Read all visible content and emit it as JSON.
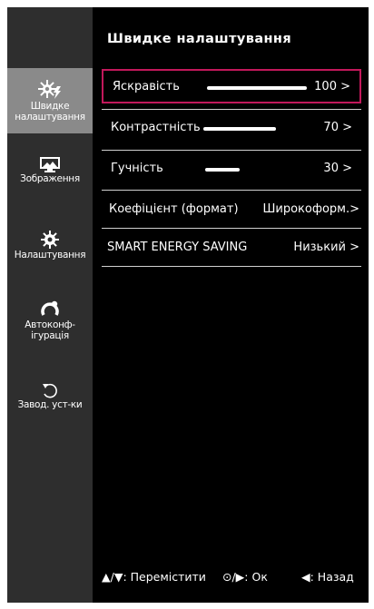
{
  "sidebar": {
    "items": [
      {
        "label1": "Швидке",
        "label2": "налаштування",
        "icon": "quick-settings-icon",
        "active": true
      },
      {
        "label1": "Зображення",
        "icon": "picture-icon",
        "active": false
      },
      {
        "label1": "Налаштування",
        "icon": "gear-icon",
        "active": false
      },
      {
        "label1": "Автоконф-",
        "label2": "ігурація",
        "icon": "auto-config-icon",
        "active": false
      },
      {
        "label1": "Завод. уст-ки",
        "icon": "reset-icon",
        "active": false
      }
    ]
  },
  "main": {
    "title": "Швидке налаштування",
    "rows": [
      {
        "label": "Яскравість",
        "value": "100 >",
        "slider": 1.0,
        "selected": true
      },
      {
        "label": "Контрастність",
        "value": "70 >",
        "slider": 0.7
      },
      {
        "label": "Гучність",
        "value": "30 >",
        "slider": 0.3
      },
      {
        "label": "Коефіцієнт (формат)",
        "value": "Широкоформ.>"
      },
      {
        "label": "SMART ENERGY SAVING",
        "value": "Низький >"
      }
    ]
  },
  "footer": {
    "move": "▲/▼: Перемістити",
    "ok": "⊙/▶: Ок",
    "back": "◀: Назад"
  },
  "colors": {
    "selection": "#c2185b",
    "sidebar_bg": "#2e2e2e",
    "active_item_bg": "#8a8a8a"
  }
}
